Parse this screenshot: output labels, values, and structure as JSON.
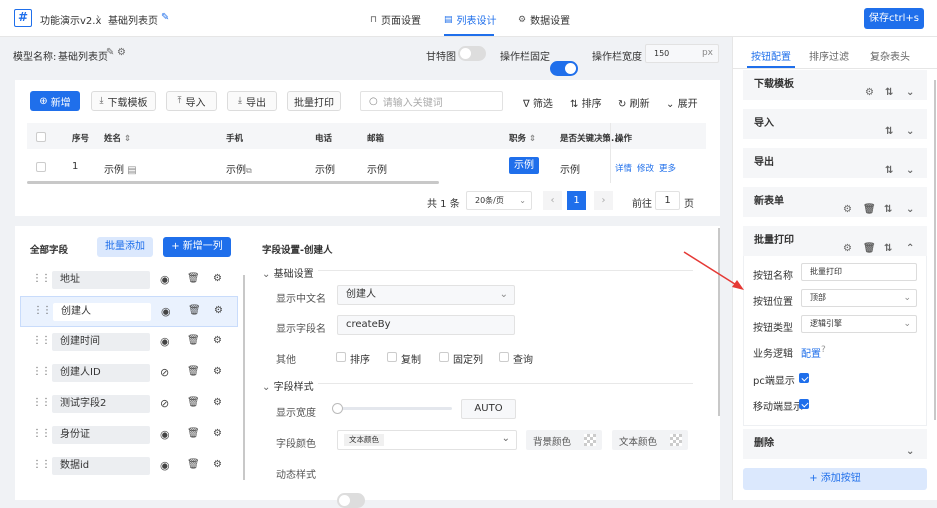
{
  "topbar": {
    "logo": "#",
    "app_title": "功能演示v2.x",
    "page_name": "基础列表页",
    "tabs": [
      "页面设置",
      "列表设计",
      "数据设置"
    ],
    "save_label": "保存ctrl+s"
  },
  "settings": {
    "model_label": "模型名称:",
    "model_name": "基础列表页",
    "gantt_label": "甘特图",
    "fixed_col_label": "操作栏固定",
    "col_width_label": "操作栏宽度",
    "col_width_value": "150",
    "col_width_unit": "px"
  },
  "right_tabs": [
    "按钮配置",
    "排序过滤",
    "复杂表头"
  ],
  "toolbar": {
    "add": "新增",
    "download_template": "下载模板",
    "import": "导入",
    "export": "导出",
    "batch_print": "批量打印",
    "search_placeholder": "请输入关键词",
    "filter": "筛选",
    "sort": "排序",
    "refresh": "刷新",
    "expand": "展开"
  },
  "table": {
    "headers": [
      "序号",
      "姓名",
      "手机",
      "电话",
      "邮箱",
      "职务",
      "是否关键决策..",
      "操作"
    ],
    "row": {
      "index": "1",
      "name": "示例",
      "phone": "示例",
      "tel": "示例",
      "email": "示例",
      "job": "示例",
      "key": "示例",
      "actions": [
        "详情",
        "修改",
        "更多"
      ]
    }
  },
  "pagination": {
    "total": "共 1 条",
    "page_size": "20条/页",
    "current": "1",
    "goto_label": "前往",
    "goto_value": "1",
    "page_unit": "页"
  },
  "fields_panel": {
    "title": "全部字段",
    "batch_add": "批量添加",
    "add_col": "新增一列",
    "fields": [
      "地址",
      "创建人",
      "创建时间",
      "创建人ID",
      "测试字段2",
      "身份证",
      "数据id"
    ]
  },
  "field_settings": {
    "title": "字段设置-创建人",
    "basic": "基础设置",
    "cn_label": "显示中文名",
    "cn_value": "创建人",
    "field_label": "显示字段名",
    "field_value": "createBy",
    "other_label": "其他",
    "other_opts": [
      "排序",
      "复制",
      "固定列",
      "查询"
    ],
    "style": "字段样式",
    "width_label": "显示宽度",
    "width_value": "AUTO",
    "color_label": "字段颜色",
    "color_value": "文本颜色",
    "bg_label": "背景颜色",
    "text_color_label": "文本颜色",
    "dynamic_label": "动态样式"
  },
  "right_panel": {
    "sections": [
      "下载模板",
      "导入",
      "导出",
      "新表单",
      "批量打印",
      "删除"
    ],
    "name_label": "按钮名称",
    "name_value": "批量打印",
    "pos_label": "按钮位置",
    "pos_value": "顶部",
    "type_label": "按钮类型",
    "type_value": "逻辑引擎",
    "logic_label": "业务逻辑",
    "logic_value": "配置",
    "pc_label": "pc端显示",
    "mobile_label": "移动端显示",
    "add_button": "添加按钮"
  },
  "colors": {
    "primary": "#1f6feb",
    "arrow": "#e53935"
  }
}
